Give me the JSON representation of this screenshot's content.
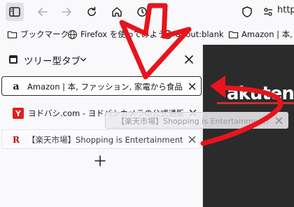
{
  "toolbar": {
    "url_text": "http"
  },
  "bookmarks": [
    {
      "label": "ブックマーク",
      "icon": "folder-icon"
    },
    {
      "label": "Firefox を使ってみよう",
      "icon": "globe-icon"
    },
    {
      "label": "about:blank",
      "icon": "globe-icon"
    },
    {
      "label": "Amazon | 本, ファ",
      "icon": "folder-icon"
    }
  ],
  "sidebar": {
    "title": "ツリー型タブ",
    "tabs": [
      {
        "label": "Amazon | 本, ファッション, 家電から食品まで | アマゾン",
        "favicon": "a",
        "favicon_color": "#111111",
        "state": "active"
      },
      {
        "label": "ヨドバシ.com - ヨドバシカメラの公式通販サイト",
        "favicon": "Y",
        "favicon_color": "#e0201b",
        "state": "normal"
      },
      {
        "label": "【楽天市場】Shopping is Entertainment!",
        "favicon": "R",
        "favicon_color": "#bf0000",
        "state": "dim"
      }
    ],
    "new_tab_symbol": "+"
  },
  "content": {
    "logo_text": "akuten"
  },
  "drag_ghost": {
    "label": "【楽天市場】Shopping is Entertainment!"
  },
  "colors": {
    "annotation": "#e8141c",
    "background": "#f9f9fb",
    "content_bg": "#2b2b2b"
  }
}
